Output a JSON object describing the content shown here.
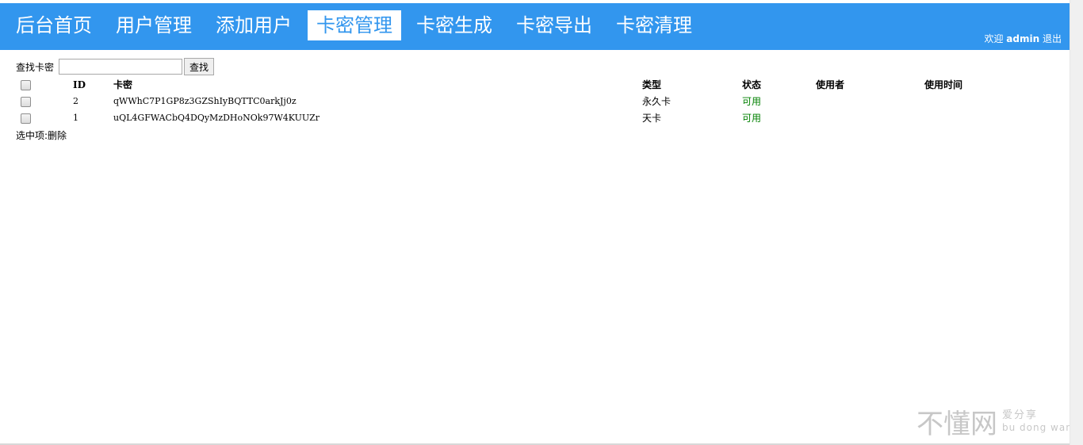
{
  "nav": {
    "items": [
      {
        "label": "后台首页",
        "active": false
      },
      {
        "label": "用户管理",
        "active": false
      },
      {
        "label": "添加用户",
        "active": false
      },
      {
        "label": "卡密管理",
        "active": true
      },
      {
        "label": "卡密生成",
        "active": false
      },
      {
        "label": "卡密导出",
        "active": false
      },
      {
        "label": "卡密清理",
        "active": false
      }
    ],
    "welcome_prefix": "欢迎",
    "username": "admin",
    "logout_label": "退出"
  },
  "search": {
    "label": "查找卡密",
    "value": "",
    "placeholder": "",
    "button_label": "查找"
  },
  "table": {
    "headers": {
      "id": "ID",
      "card": "卡密",
      "type": "类型",
      "status": "状态",
      "user": "使用者",
      "time": "使用时间"
    },
    "rows": [
      {
        "id": "2",
        "card": "qWWhC7P1GP8z3GZShIyBQTTC0arkJj0z",
        "type": "永久卡",
        "status": "可用",
        "user": "",
        "time": ""
      },
      {
        "id": "1",
        "card": "uQL4GFWACbQ4DQyMzDHoNOk97W4KUUZr",
        "type": "天卡",
        "status": "可用",
        "user": "",
        "time": ""
      }
    ]
  },
  "selection": {
    "label": "选中项:",
    "delete_label": "删除"
  },
  "watermark": {
    "main": "不懂网",
    "sub1": "爱分享",
    "sub2": "bu dong wang"
  },
  "colors": {
    "nav_bg": "#3296ee",
    "status_ok": "#008000"
  }
}
